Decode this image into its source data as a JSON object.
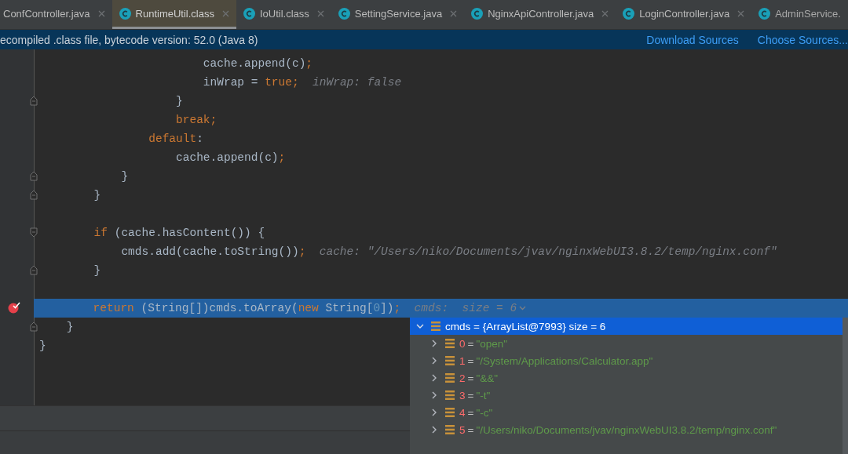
{
  "tabs": [
    {
      "label": "ConfController.java",
      "selected": false,
      "icon": false
    },
    {
      "label": "RuntimeUtil.class",
      "selected": true,
      "icon": true
    },
    {
      "label": "IoUtil.class",
      "selected": false,
      "icon": true
    },
    {
      "label": "SettingService.java",
      "selected": false,
      "icon": true
    },
    {
      "label": "NginxApiController.java",
      "selected": false,
      "icon": true
    },
    {
      "label": "LoginController.java",
      "selected": false,
      "icon": true
    },
    {
      "label": "AdminService.",
      "selected": false,
      "icon": true,
      "cut": true
    }
  ],
  "banner": {
    "text": "ecompiled .class file, bytecode version: 52.0 (Java 8)",
    "links": [
      "Download Sources",
      "Choose Sources..."
    ]
  },
  "lines": [
    {
      "fold_start": false,
      "fold_end": false,
      "highlighted": false,
      "breakpoint": false,
      "tokens": [
        {
          "kind": "plain",
          "text": "                        cache.append(c)"
        },
        {
          "kind": "keyword",
          "text": ";"
        }
      ]
    },
    {
      "fold_start": false,
      "fold_end": false,
      "highlighted": false,
      "breakpoint": false,
      "tokens": [
        {
          "kind": "plain",
          "text": "                        inWrap = "
        },
        {
          "kind": "keyword",
          "text": "true;"
        },
        {
          "kind": "hint",
          "text": "  inWrap: false"
        }
      ]
    },
    {
      "fold_start": false,
      "fold_end": true,
      "highlighted": false,
      "breakpoint": false,
      "tokens": [
        {
          "kind": "plain",
          "text": "                    }"
        }
      ]
    },
    {
      "fold_start": false,
      "fold_end": false,
      "highlighted": false,
      "breakpoint": false,
      "tokens": [
        {
          "kind": "keyword",
          "text": "                    break;"
        }
      ]
    },
    {
      "fold_start": false,
      "fold_end": false,
      "highlighted": false,
      "breakpoint": false,
      "tokens": [
        {
          "kind": "keyword",
          "text": "                default"
        },
        {
          "kind": "plain",
          "text": ":"
        }
      ]
    },
    {
      "fold_start": false,
      "fold_end": false,
      "highlighted": false,
      "breakpoint": false,
      "tokens": [
        {
          "kind": "plain",
          "text": "                    cache.append(c)"
        },
        {
          "kind": "keyword",
          "text": ";"
        }
      ]
    },
    {
      "fold_start": false,
      "fold_end": true,
      "highlighted": false,
      "breakpoint": false,
      "tokens": [
        {
          "kind": "plain",
          "text": "            }"
        }
      ]
    },
    {
      "fold_start": false,
      "fold_end": true,
      "highlighted": false,
      "breakpoint": false,
      "tokens": [
        {
          "kind": "plain",
          "text": "        }"
        }
      ]
    },
    {
      "fold_start": false,
      "fold_end": false,
      "highlighted": false,
      "breakpoint": false
    },
    {
      "fold_start": true,
      "fold_end": false,
      "highlighted": false,
      "breakpoint": false,
      "tokens": [
        {
          "kind": "keyword",
          "text": "        if"
        },
        {
          "kind": "plain",
          "text": " (cache.hasContent()) {"
        }
      ]
    },
    {
      "fold_start": false,
      "fold_end": false,
      "highlighted": false,
      "breakpoint": false,
      "tokens": [
        {
          "kind": "plain",
          "text": "            cmds.add(cache.toString())"
        },
        {
          "kind": "keyword",
          "text": ";"
        },
        {
          "kind": "hint",
          "text": "  cache: \"/Users/niko/Documents/jvav/nginxWebUI3.8.2/temp/nginx.conf\""
        }
      ]
    },
    {
      "fold_start": false,
      "fold_end": true,
      "highlighted": false,
      "breakpoint": false,
      "tokens": [
        {
          "kind": "plain",
          "text": "        }"
        }
      ]
    },
    {
      "fold_start": false,
      "fold_end": false,
      "highlighted": false,
      "breakpoint": false
    },
    {
      "fold_start": false,
      "fold_end": false,
      "highlighted": true,
      "breakpoint": true,
      "tokens": [
        {
          "kind": "keyword",
          "text": "        return"
        },
        {
          "kind": "plain",
          "text": " (String[])cmds.toArray("
        },
        {
          "kind": "keyword",
          "text": "new"
        },
        {
          "kind": "plain",
          "text": " String["
        },
        {
          "kind": "number",
          "text": "0"
        },
        {
          "kind": "plain",
          "text": "])"
        },
        {
          "kind": "keyword",
          "text": ";"
        },
        {
          "kind": "hint",
          "text": "  cmds:  size = 6"
        }
      ]
    },
    {
      "fold_start": false,
      "fold_end": true,
      "highlighted": false,
      "breakpoint": false,
      "tokens": [
        {
          "kind": "plain",
          "text": "    }"
        }
      ]
    },
    {
      "fold_start": false,
      "fold_end": false,
      "highlighted": false,
      "breakpoint": false,
      "tokens": [
        {
          "kind": "plain",
          "text": "}"
        }
      ]
    }
  ],
  "variables": {
    "header": {
      "text": "cmds = {ArrayList@7993}  size = 6",
      "expanded": true,
      "selected": true
    },
    "items": [
      {
        "index": "0",
        "eq": "=",
        "value": "\"open\"",
        "expanded": false
      },
      {
        "index": "1",
        "eq": "=",
        "value": "\"/System/Applications/Calculator.app\"",
        "expanded": false
      },
      {
        "index": "2",
        "eq": "=",
        "value": "\"&&\"",
        "expanded": false
      },
      {
        "index": "3",
        "eq": "=",
        "value": "\"-t\"",
        "expanded": false
      },
      {
        "index": "4",
        "eq": "=",
        "value": "\"-c\"",
        "expanded": false
      },
      {
        "index": "5",
        "eq": "=",
        "value": "\"/Users/niko/Documents/jvav/nginxWebUI3.8.2/temp/nginx.conf\"",
        "expanded": false
      }
    ]
  }
}
